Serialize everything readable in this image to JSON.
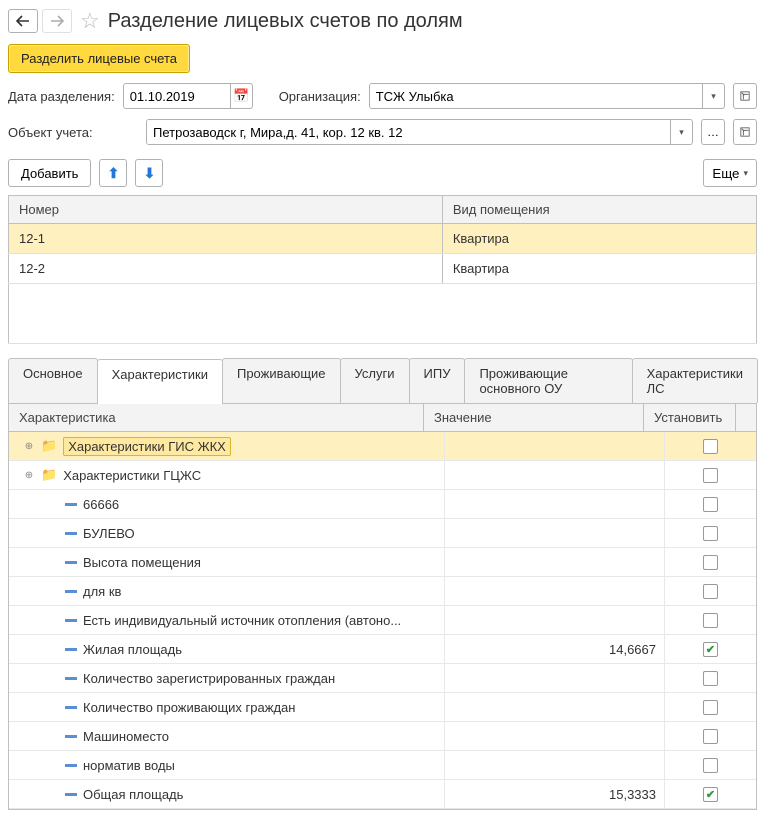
{
  "header": {
    "title": "Разделение лицевых счетов по долям"
  },
  "primaryBtn": "Разделить лицевые счета",
  "fields": {
    "dateLabel": "Дата разделения:",
    "dateValue": "01.10.2019",
    "orgLabel": "Организация:",
    "orgValue": "ТСЖ Улыбка",
    "objLabel": "Объект учета:",
    "objValue": "Петрозаводск г, Мира,д. 41, кор. 12 кв. 12"
  },
  "toolbar": {
    "add": "Добавить",
    "more": "Еще"
  },
  "accountsGrid": {
    "colNumber": "Номер",
    "colType": "Вид помещения",
    "rows": [
      {
        "num": "12-1",
        "type": "Квартира",
        "selected": true
      },
      {
        "num": "12-2",
        "type": "Квартира",
        "selected": false
      }
    ]
  },
  "tabs": [
    "Основное",
    "Характеристики",
    "Проживающие",
    "Услуги",
    "ИПУ",
    "Проживающие основного ОУ",
    "Характеристики ЛС"
  ],
  "activeTab": 1,
  "charGrid": {
    "colChar": "Характеристика",
    "colVal": "Значение",
    "colSet": "Установить",
    "rows": [
      {
        "indent": 0,
        "kind": "folder",
        "label": "Характеристики ГИС ЖКХ",
        "value": "",
        "checked": false,
        "selected": true
      },
      {
        "indent": 0,
        "kind": "folder",
        "label": "Характеристики ГЦЖС",
        "value": "",
        "checked": false
      },
      {
        "indent": 1,
        "kind": "item",
        "label": "66666",
        "value": "",
        "checked": false
      },
      {
        "indent": 1,
        "kind": "item",
        "label": "БУЛЕВО",
        "value": "",
        "checked": false
      },
      {
        "indent": 1,
        "kind": "item",
        "label": "Высота помещения",
        "value": "",
        "checked": false
      },
      {
        "indent": 1,
        "kind": "item",
        "label": "для кв",
        "value": "",
        "checked": false
      },
      {
        "indent": 1,
        "kind": "item",
        "label": "Есть индивидуальный источник отопления (автоно...",
        "value": "",
        "checked": false
      },
      {
        "indent": 1,
        "kind": "item",
        "label": "Жилая площадь",
        "value": "14,6667",
        "checked": true
      },
      {
        "indent": 1,
        "kind": "item",
        "label": "Количество зарегистрированных граждан",
        "value": "",
        "checked": false
      },
      {
        "indent": 1,
        "kind": "item",
        "label": "Количество проживающих граждан",
        "value": "",
        "checked": false
      },
      {
        "indent": 1,
        "kind": "item",
        "label": "Машиноместо",
        "value": "",
        "checked": false
      },
      {
        "indent": 1,
        "kind": "item",
        "label": "норматив воды",
        "value": "",
        "checked": false
      },
      {
        "indent": 1,
        "kind": "item",
        "label": "Общая площадь",
        "value": "15,3333",
        "checked": true
      }
    ]
  }
}
